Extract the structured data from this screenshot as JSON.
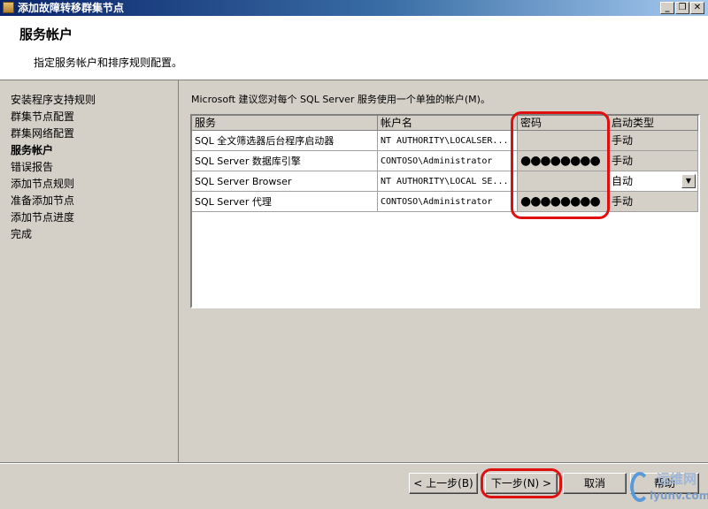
{
  "window": {
    "title": "添加故障转移群集节点",
    "controls": {
      "minimize": "_",
      "restore": "❐",
      "close": "✕"
    }
  },
  "header": {
    "title": "服务帐户",
    "description": "指定服务帐户和排序规则配置。"
  },
  "nav": {
    "items": [
      {
        "label": "安装程序支持规则"
      },
      {
        "label": "群集节点配置"
      },
      {
        "label": "群集网络配置"
      },
      {
        "label": "服务帐户",
        "active": true
      },
      {
        "label": "错误报告"
      },
      {
        "label": "添加节点规则"
      },
      {
        "label": "准备添加节点"
      },
      {
        "label": "添加节点进度"
      },
      {
        "label": "完成"
      }
    ]
  },
  "main": {
    "intro": "Microsoft 建议您对每个 SQL Server 服务使用一个单独的帐户(M)。",
    "columns": [
      "服务",
      "帐户名",
      "密码",
      "启动类型"
    ],
    "rows": [
      {
        "service": "SQL 全文筛选器后台程序启动器",
        "account": "NT AUTHORITY\\LOCALSER...",
        "password": "",
        "startup": "手动"
      },
      {
        "service": "SQL Server 数据库引擎",
        "account": "CONTOSO\\Administrator",
        "password": "●●●●●●●●",
        "startup": "手动"
      },
      {
        "service": "SQL Server Browser",
        "account": "NT AUTHORITY\\LOCAL SE...",
        "password": "",
        "startup": "自动"
      },
      {
        "service": "SQL Server 代理",
        "account": "CONTOSO\\Administrator",
        "password": "●●●●●●●●",
        "startup": "手动"
      }
    ]
  },
  "buttons": {
    "back": "< 上一步(B)",
    "next": "下一步(N) >",
    "cancel": "取消",
    "help": "帮助"
  },
  "watermark": {
    "text": "运维网",
    "sub": "iyunv.com"
  },
  "colors": {
    "highlight": "#e01010",
    "titlebar": "#0a246a"
  }
}
